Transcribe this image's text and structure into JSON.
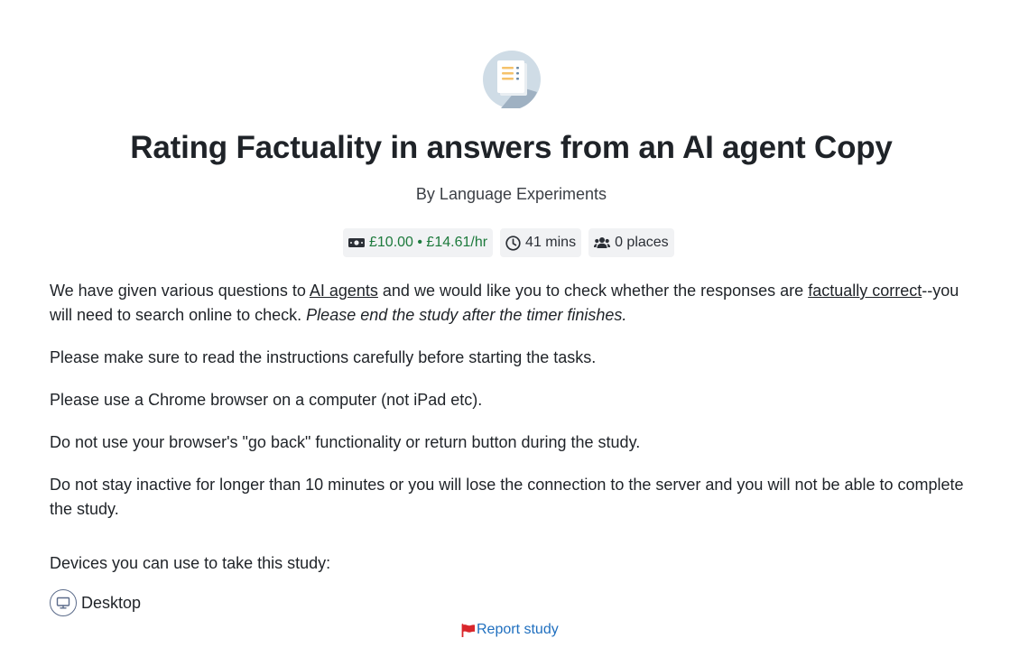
{
  "study": {
    "title": "Rating Factuality in answers from an AI agent Copy",
    "researcher": "By Language Experiments",
    "icon": "document-list-icon"
  },
  "pills": {
    "reward": "£10.00 • £14.61/hr",
    "duration": "41 mins",
    "places": "0 places",
    "reward_color": "#1d7a3c"
  },
  "description": {
    "p1_before_link1": "We have given various questions to ",
    "link1": "AI agents",
    "p1_between": " and we would like you to check whether the responses are ",
    "link2": "factually correct",
    "p1_after": "--you will need to search online to check. ",
    "p1_italic": "Please end the study after the timer finishes.",
    "p2": "Please make sure to read the instructions carefully before starting the tasks.",
    "p3": "Please use a Chrome browser on a computer (not iPad etc).",
    "p4": "Do not use your browser's \"go back\" functionality or return button during the study.",
    "p5": "Do not stay inactive for longer than 10 minutes or you will lose the connection to the server and you will not be able to complete the study."
  },
  "devices": {
    "label": "Devices you can use to take this study:",
    "items": [
      "Desktop"
    ]
  },
  "report": {
    "label": "Report study",
    "link_color": "#1f6fbf",
    "flag_color": "#d9262b"
  }
}
